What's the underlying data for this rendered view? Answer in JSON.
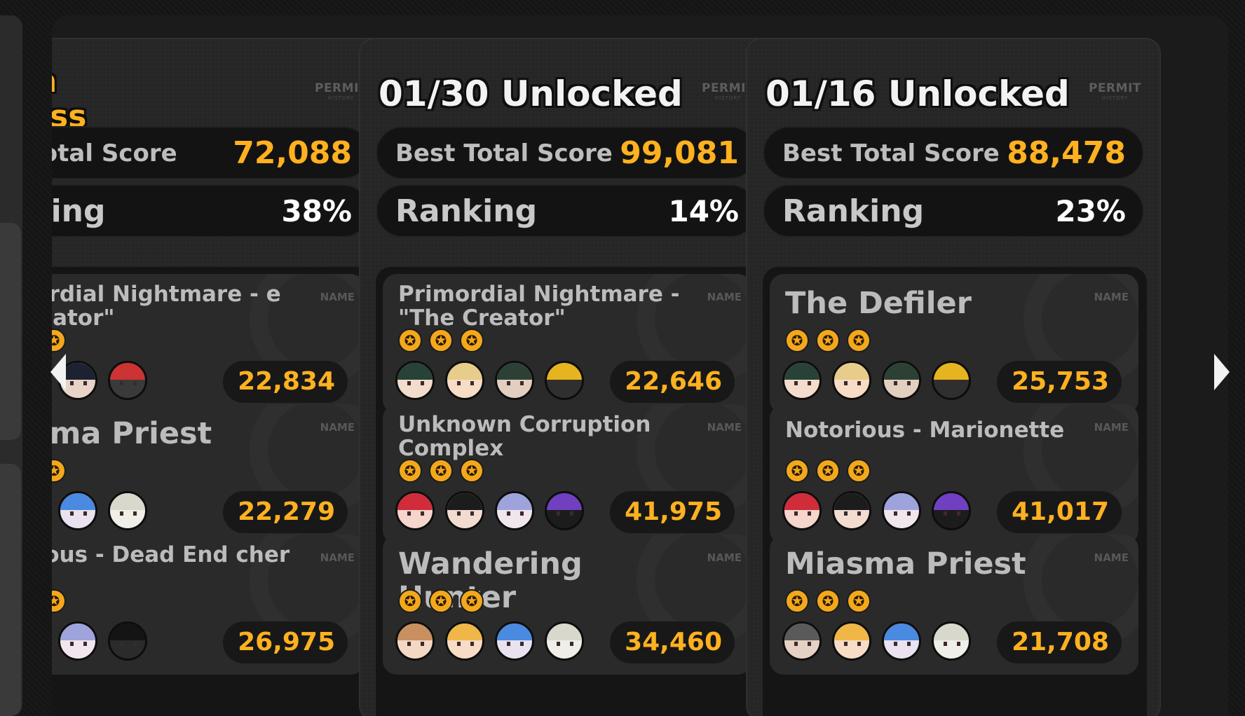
{
  "permit_badge": {
    "top": "PERMIT",
    "bottom": "HISTORY"
  },
  "name_label": "NAME",
  "star_glyph": "✪",
  "colors": {
    "accent": "#ffb11f",
    "background": "#151515",
    "panel": "#262626",
    "card": "#2a2a2a"
  },
  "panels": [
    {
      "title_lines": [
        "d in",
        "gress"
      ],
      "score_label": "t Total Score",
      "score_value": "72,088",
      "rank_label": "nking",
      "rank_value": "38%",
      "bosses": [
        {
          "name": "mordial Nightmare - e Creator\"",
          "stars": 2,
          "score": "22,834",
          "avatars": [
            "#e8cc8a",
            "#1d2233",
            "#cc3333"
          ]
        },
        {
          "name": "asma Priest",
          "stars": 2,
          "score": "22,279",
          "avatars": [
            "#f0b648",
            "#4a8ae0",
            "#d8d8cc"
          ]
        },
        {
          "name": "orious - Dead End cher",
          "stars": 2,
          "score": "26,975",
          "avatars": [
            "#1c1c1c",
            "#9fa3dc",
            "#141414"
          ]
        }
      ]
    },
    {
      "title_lines": [
        "01/30 Unlocked"
      ],
      "score_label": "Best Total Score",
      "score_value": "99,081",
      "rank_label": "Ranking",
      "rank_value": "14%",
      "bosses": [
        {
          "name": "Primordial Nightmare - \"The Creator\"",
          "stars": 3,
          "score": "22,646",
          "avatars": [
            "#274237",
            "#e8cc8a",
            "#2d4036",
            "#e6b420"
          ]
        },
        {
          "name": "Unknown Corruption Complex",
          "stars": 3,
          "score": "41,975",
          "avatars": [
            "#d02c3a",
            "#1c1c1c",
            "#9fa3dc",
            "#7040c0"
          ]
        },
        {
          "name": "Wandering Hunter",
          "stars": 3,
          "score": "34,460",
          "avatars": [
            "#c89060",
            "#f0b648",
            "#4a8ae0",
            "#d8d8cc"
          ]
        }
      ]
    },
    {
      "title_lines": [
        "01/16 Unlocked"
      ],
      "score_label": "Best Total Score",
      "score_value": "88,478",
      "rank_label": "Ranking",
      "rank_value": "23%",
      "bosses": [
        {
          "name": "The Defiler",
          "stars": 3,
          "score": "25,753",
          "avatars": [
            "#274237",
            "#e8cc8a",
            "#2d4036",
            "#e6b420"
          ]
        },
        {
          "name": "Notorious - Marionette",
          "stars": 3,
          "score": "41,017",
          "avatars": [
            "#d02c3a",
            "#1c1c1c",
            "#9fa3dc",
            "#7040c0"
          ]
        },
        {
          "name": "Miasma Priest",
          "stars": 3,
          "score": "21,708",
          "avatars": [
            "#5a5a5a",
            "#f0b648",
            "#4a8ae0",
            "#d8d8cc"
          ]
        }
      ]
    }
  ]
}
